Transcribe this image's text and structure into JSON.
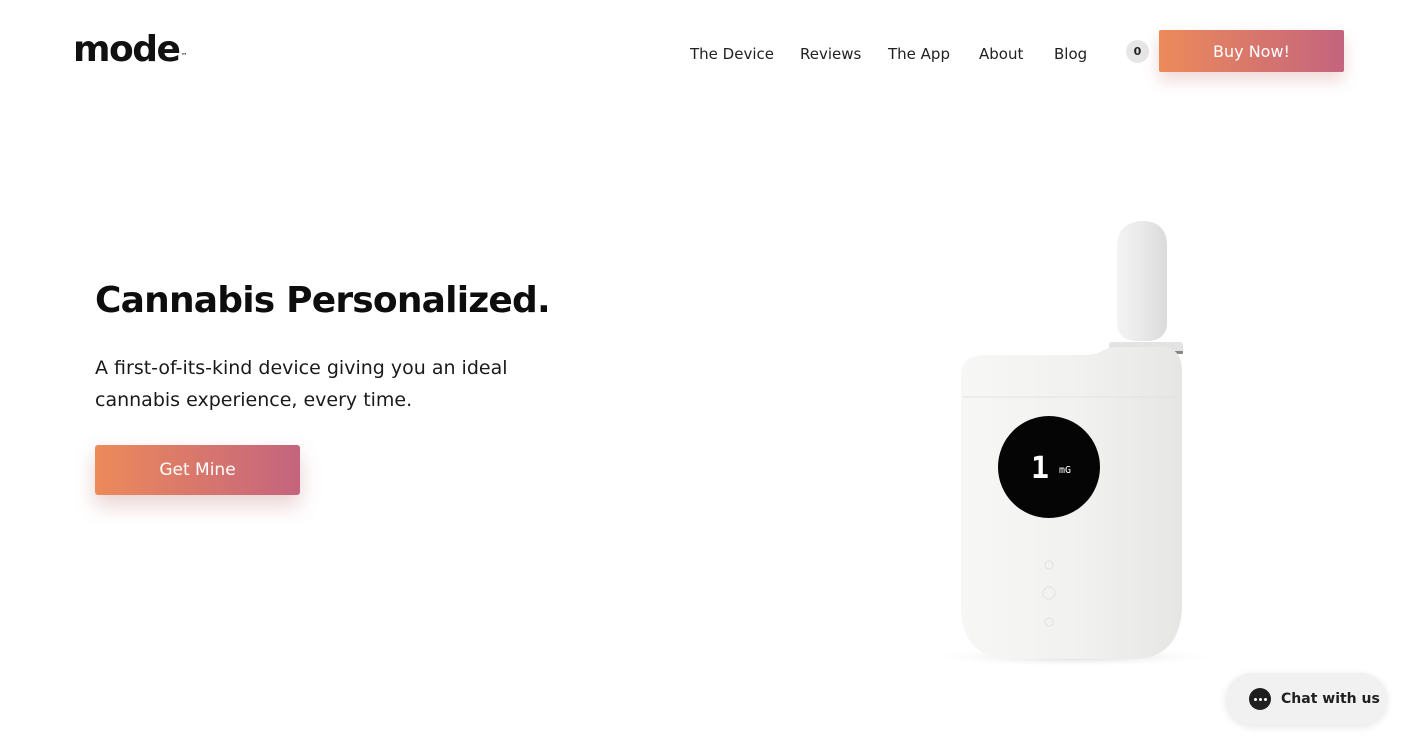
{
  "header": {
    "logo": "mode",
    "logo_mark": "™",
    "nav": [
      {
        "label": "The Device"
      },
      {
        "label": "Reviews"
      },
      {
        "label": "The App"
      },
      {
        "label": "About"
      },
      {
        "label": "Blog"
      }
    ],
    "cart_count": "0",
    "buy_label": "Buy Now!"
  },
  "hero": {
    "title": "Cannabis Personalized.",
    "subtitle": "A first-of-its-kind device giving you an ideal cannabis experience, every time.",
    "cta_label": "Get Mine"
  },
  "device": {
    "display_value": "1",
    "display_unit": "mG"
  },
  "chat": {
    "label": "Chat with us"
  },
  "colors": {
    "gradient_start": "#ec8a5a",
    "gradient_end": "#c4647e",
    "text": "#111111",
    "background": "#ffffff"
  }
}
